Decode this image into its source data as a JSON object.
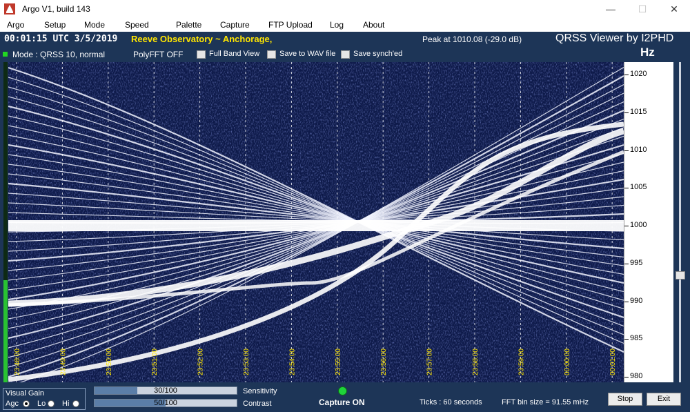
{
  "window": {
    "title": "Argo V1, build 143",
    "minimize": "—",
    "maximize": "☐",
    "close": "✕"
  },
  "menu": [
    "Argo",
    "Setup",
    "Mode",
    "Speed",
    "Palette",
    "Capture",
    "FTP Upload",
    "Log",
    "About"
  ],
  "info": {
    "utc": "00:01:15 UTC  3/5/2019",
    "station": "Reeve Observatory ~ Anchorage,",
    "peak": "Peak at    1010.08 (-29.0 dB)",
    "brand": "QRSS Viewer by I2PHD",
    "hz": "Hz"
  },
  "options": {
    "mode": "Mode : QRSS 10, normal",
    "polyfft": "PolyFFT OFF",
    "full_band": "Full Band View",
    "save_wav": "Save to WAV file",
    "save_synched": "Save synch'ed"
  },
  "freq_axis": {
    "labels": [
      "1020",
      "1015",
      "1010",
      "1005",
      "1000",
      "995",
      "990",
      "985",
      "980"
    ],
    "min": 980,
    "max": 1020
  },
  "time_axis": {
    "labels": [
      "23:48:00",
      "23:49:00",
      "23:50:00",
      "23:51:00",
      "23:52:00",
      "23:53:00",
      "23:54:00",
      "23:55:00",
      "23:56:00",
      "23:57:00",
      "23:58:00",
      "23:59:00",
      "00:00:00",
      "00:01:00"
    ]
  },
  "level_meter": {
    "fill_fraction": 0.32
  },
  "bottom": {
    "visual_gain": "Visual Gain",
    "agc": "Agc",
    "lo": "Lo",
    "hi": "Hi",
    "sensitivity": {
      "value_text": "30/100",
      "value": 30,
      "label": "Sensitivity"
    },
    "contrast": {
      "value_text": "50/100",
      "value": 50,
      "label": "Contrast"
    },
    "capture": "Capture ON",
    "ticks": "Ticks   : 60 seconds",
    "fft_bin": "FFT bin size = 91.55 mHz",
    "stop": "Stop",
    "exit": "Exit"
  },
  "colors": {
    "panel": "#1d3557",
    "trace": "#ffffff",
    "spectro_bg": "#0e1a4a",
    "station": "#ffe600",
    "grid": "#ffffff",
    "time_label": "#ffe600",
    "led": "#22d622"
  }
}
